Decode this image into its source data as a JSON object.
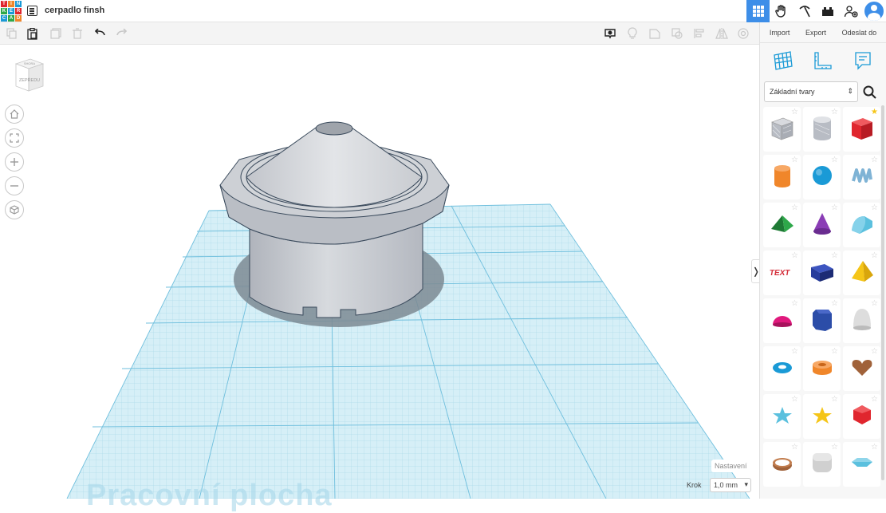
{
  "app": {
    "logo_letters": [
      "T",
      "I",
      "N",
      "K",
      "E",
      "R",
      "C",
      "A",
      "D"
    ],
    "document_title": "cerpadlo finsh"
  },
  "header_right": {
    "icons": [
      "grid-view-icon",
      "hand-icon",
      "pickaxe-icon",
      "bricks-icon",
      "add-user-icon",
      "profile-icon"
    ]
  },
  "panel": {
    "import_label": "Import",
    "export_label": "Export",
    "send_label": "Odeslat do",
    "shape_category": "Základní tvary"
  },
  "viewport": {
    "viewcube_top": "SHORA",
    "viewcube_front": "ZEPŘEDU",
    "workplane_text": "Pracovní plocha",
    "settings_label": "Nastavení",
    "step_label": "Krok",
    "step_value": "1,0 mm"
  },
  "shapes": [
    {
      "name": "box-hole",
      "color": "#b8bcc4",
      "favorite": false
    },
    {
      "name": "cylinder-hole",
      "color": "#b8bcc4",
      "favorite": false
    },
    {
      "name": "box",
      "color": "#e0262e",
      "favorite": true
    },
    {
      "name": "cylinder",
      "color": "#f0862a",
      "favorite": false
    },
    {
      "name": "sphere",
      "color": "#1a9ad6",
      "favorite": false
    },
    {
      "name": "scribble",
      "color": "#7fb3d5",
      "favorite": false
    },
    {
      "name": "roof",
      "color": "#2ea84a",
      "favorite": false
    },
    {
      "name": "cone",
      "color": "#8a3db5",
      "favorite": false
    },
    {
      "name": "round-roof",
      "color": "#5bc0de",
      "favorite": false
    },
    {
      "name": "text",
      "color": "#d42e3a",
      "favorite": false
    },
    {
      "name": "wedge",
      "color": "#283d9c",
      "favorite": false
    },
    {
      "name": "pyramid",
      "color": "#f5c518",
      "favorite": false
    },
    {
      "name": "half-sphere",
      "color": "#e0197d",
      "favorite": false
    },
    {
      "name": "polygon",
      "color": "#2c4da8",
      "favorite": false
    },
    {
      "name": "paraboloid",
      "color": "#dddddd",
      "favorite": false
    },
    {
      "name": "torus",
      "color": "#1a9ad6",
      "favorite": false
    },
    {
      "name": "tube",
      "color": "#f0862a",
      "favorite": false
    },
    {
      "name": "heart",
      "color": "#a0623a",
      "favorite": false
    },
    {
      "name": "star",
      "color": "#5bc0de",
      "favorite": false
    },
    {
      "name": "star-yellow",
      "color": "#f5c518",
      "favorite": false
    },
    {
      "name": "icosahedron",
      "color": "#e0262e",
      "favorite": false
    },
    {
      "name": "ring",
      "color": "#a0623a",
      "favorite": false
    },
    {
      "name": "round-cube",
      "color": "#d0d0d0",
      "favorite": false
    },
    {
      "name": "gem",
      "color": "#5bc0de",
      "favorite": false
    }
  ]
}
